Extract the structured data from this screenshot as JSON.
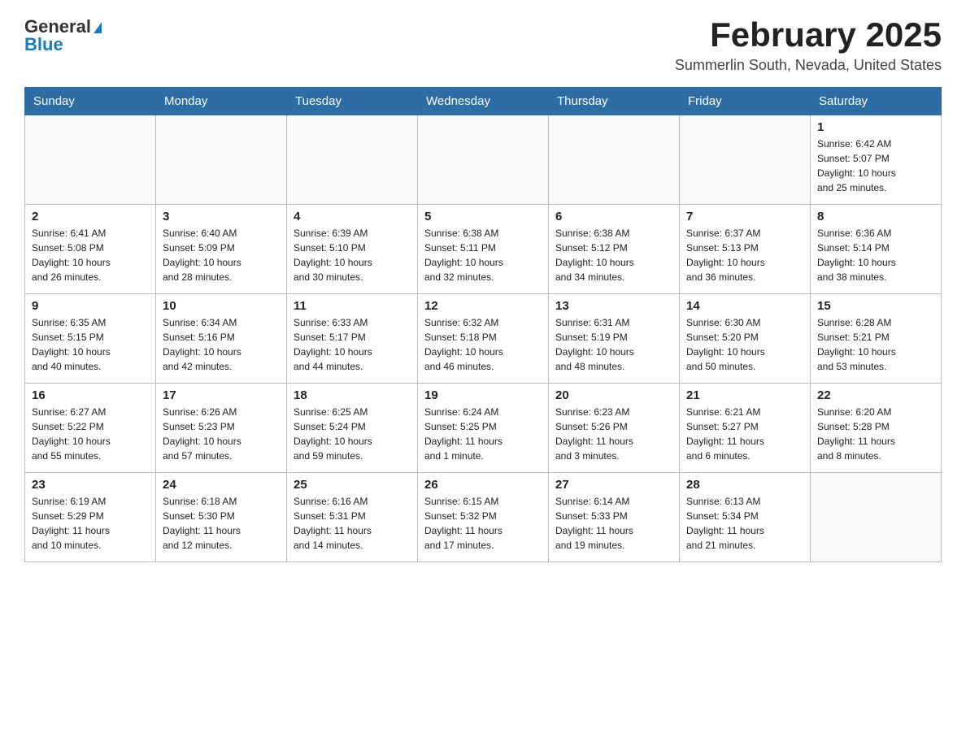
{
  "header": {
    "logo_general": "General",
    "logo_blue": "Blue",
    "month_title": "February 2025",
    "location": "Summerlin South, Nevada, United States"
  },
  "days_of_week": [
    "Sunday",
    "Monday",
    "Tuesday",
    "Wednesday",
    "Thursday",
    "Friday",
    "Saturday"
  ],
  "weeks": [
    [
      {
        "day": "",
        "info": ""
      },
      {
        "day": "",
        "info": ""
      },
      {
        "day": "",
        "info": ""
      },
      {
        "day": "",
        "info": ""
      },
      {
        "day": "",
        "info": ""
      },
      {
        "day": "",
        "info": ""
      },
      {
        "day": "1",
        "info": "Sunrise: 6:42 AM\nSunset: 5:07 PM\nDaylight: 10 hours\nand 25 minutes."
      }
    ],
    [
      {
        "day": "2",
        "info": "Sunrise: 6:41 AM\nSunset: 5:08 PM\nDaylight: 10 hours\nand 26 minutes."
      },
      {
        "day": "3",
        "info": "Sunrise: 6:40 AM\nSunset: 5:09 PM\nDaylight: 10 hours\nand 28 minutes."
      },
      {
        "day": "4",
        "info": "Sunrise: 6:39 AM\nSunset: 5:10 PM\nDaylight: 10 hours\nand 30 minutes."
      },
      {
        "day": "5",
        "info": "Sunrise: 6:38 AM\nSunset: 5:11 PM\nDaylight: 10 hours\nand 32 minutes."
      },
      {
        "day": "6",
        "info": "Sunrise: 6:38 AM\nSunset: 5:12 PM\nDaylight: 10 hours\nand 34 minutes."
      },
      {
        "day": "7",
        "info": "Sunrise: 6:37 AM\nSunset: 5:13 PM\nDaylight: 10 hours\nand 36 minutes."
      },
      {
        "day": "8",
        "info": "Sunrise: 6:36 AM\nSunset: 5:14 PM\nDaylight: 10 hours\nand 38 minutes."
      }
    ],
    [
      {
        "day": "9",
        "info": "Sunrise: 6:35 AM\nSunset: 5:15 PM\nDaylight: 10 hours\nand 40 minutes."
      },
      {
        "day": "10",
        "info": "Sunrise: 6:34 AM\nSunset: 5:16 PM\nDaylight: 10 hours\nand 42 minutes."
      },
      {
        "day": "11",
        "info": "Sunrise: 6:33 AM\nSunset: 5:17 PM\nDaylight: 10 hours\nand 44 minutes."
      },
      {
        "day": "12",
        "info": "Sunrise: 6:32 AM\nSunset: 5:18 PM\nDaylight: 10 hours\nand 46 minutes."
      },
      {
        "day": "13",
        "info": "Sunrise: 6:31 AM\nSunset: 5:19 PM\nDaylight: 10 hours\nand 48 minutes."
      },
      {
        "day": "14",
        "info": "Sunrise: 6:30 AM\nSunset: 5:20 PM\nDaylight: 10 hours\nand 50 minutes."
      },
      {
        "day": "15",
        "info": "Sunrise: 6:28 AM\nSunset: 5:21 PM\nDaylight: 10 hours\nand 53 minutes."
      }
    ],
    [
      {
        "day": "16",
        "info": "Sunrise: 6:27 AM\nSunset: 5:22 PM\nDaylight: 10 hours\nand 55 minutes."
      },
      {
        "day": "17",
        "info": "Sunrise: 6:26 AM\nSunset: 5:23 PM\nDaylight: 10 hours\nand 57 minutes."
      },
      {
        "day": "18",
        "info": "Sunrise: 6:25 AM\nSunset: 5:24 PM\nDaylight: 10 hours\nand 59 minutes."
      },
      {
        "day": "19",
        "info": "Sunrise: 6:24 AM\nSunset: 5:25 PM\nDaylight: 11 hours\nand 1 minute."
      },
      {
        "day": "20",
        "info": "Sunrise: 6:23 AM\nSunset: 5:26 PM\nDaylight: 11 hours\nand 3 minutes."
      },
      {
        "day": "21",
        "info": "Sunrise: 6:21 AM\nSunset: 5:27 PM\nDaylight: 11 hours\nand 6 minutes."
      },
      {
        "day": "22",
        "info": "Sunrise: 6:20 AM\nSunset: 5:28 PM\nDaylight: 11 hours\nand 8 minutes."
      }
    ],
    [
      {
        "day": "23",
        "info": "Sunrise: 6:19 AM\nSunset: 5:29 PM\nDaylight: 11 hours\nand 10 minutes."
      },
      {
        "day": "24",
        "info": "Sunrise: 6:18 AM\nSunset: 5:30 PM\nDaylight: 11 hours\nand 12 minutes."
      },
      {
        "day": "25",
        "info": "Sunrise: 6:16 AM\nSunset: 5:31 PM\nDaylight: 11 hours\nand 14 minutes."
      },
      {
        "day": "26",
        "info": "Sunrise: 6:15 AM\nSunset: 5:32 PM\nDaylight: 11 hours\nand 17 minutes."
      },
      {
        "day": "27",
        "info": "Sunrise: 6:14 AM\nSunset: 5:33 PM\nDaylight: 11 hours\nand 19 minutes."
      },
      {
        "day": "28",
        "info": "Sunrise: 6:13 AM\nSunset: 5:34 PM\nDaylight: 11 hours\nand 21 minutes."
      },
      {
        "day": "",
        "info": ""
      }
    ]
  ]
}
